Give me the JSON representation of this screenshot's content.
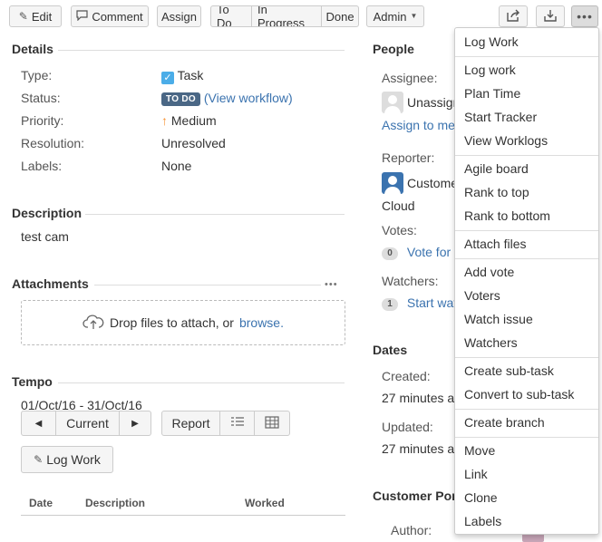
{
  "toolbar": {
    "edit": "Edit",
    "comment": "Comment",
    "assign": "Assign",
    "workflow": [
      "To Do",
      "In Progress",
      "Done"
    ],
    "admin": "Admin"
  },
  "details": {
    "title": "Details",
    "type_label": "Type:",
    "type_value": "Task",
    "status_label": "Status:",
    "status_value": "TO DO",
    "status_link": "(View workflow)",
    "priority_label": "Priority:",
    "priority_value": "Medium",
    "resolution_label": "Resolution:",
    "resolution_value": "Unresolved",
    "labels_label": "Labels:",
    "labels_value": "None"
  },
  "description": {
    "title": "Description",
    "text": "test cam"
  },
  "attachments": {
    "title": "Attachments",
    "drop_text": "Drop files to attach, or",
    "browse": "browse."
  },
  "tempo": {
    "title": "Tempo",
    "range": "01/Oct/16 - 31/Oct/16",
    "current": "Current",
    "report": "Report",
    "log_work": "Log Work",
    "columns": [
      "Date",
      "Description",
      "Worked"
    ]
  },
  "people": {
    "title": "People",
    "assignee_label": "Assignee:",
    "assignee_value": "Unassign",
    "assign_to_me": "Assign to me",
    "reporter_label": "Reporter:",
    "reporter_value": "Custome",
    "reporter_value2": "Cloud",
    "votes_label": "Votes:",
    "votes_count": "0",
    "vote_link": "Vote for t",
    "watchers_label": "Watchers:",
    "watchers_count": "1",
    "watch_link": "Start wat"
  },
  "dates": {
    "title": "Dates",
    "created_label": "Created:",
    "created_value": "27 minutes a",
    "updated_label": "Updated:",
    "updated_value": "27 minutes a"
  },
  "customer_portal": {
    "title": "Customer Por",
    "author_label": "Author:"
  },
  "menu": {
    "items": [
      "Log Work",
      "Log work",
      "Plan Time",
      "Start Tracker",
      "View Worklogs",
      "Agile board",
      "Rank to top",
      "Rank to bottom",
      "Attach files",
      "Add vote",
      "Voters",
      "Watch issue",
      "Watchers",
      "Create sub-task",
      "Convert to sub-task",
      "Create branch",
      "Move",
      "Link",
      "Clone",
      "Labels"
    ]
  },
  "colors": {
    "link": "#3b73af",
    "status_badge": "#4a6785",
    "priority_arrow": "#f79232"
  }
}
